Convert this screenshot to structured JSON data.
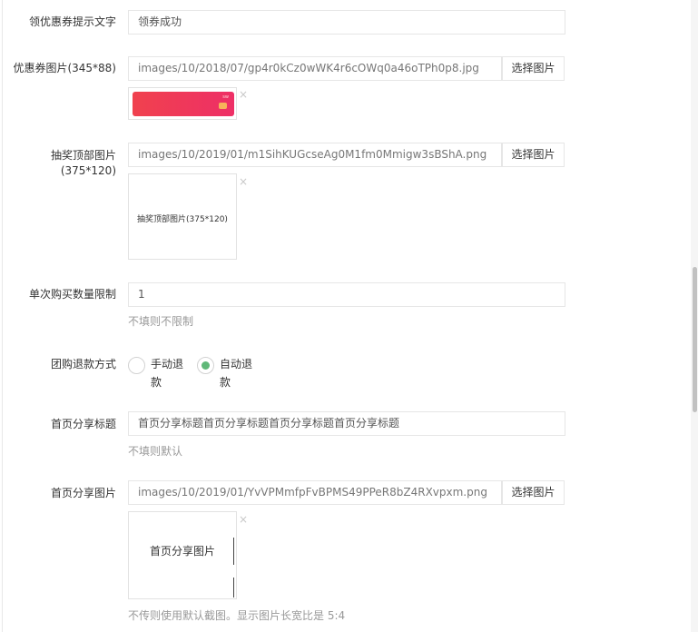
{
  "form": {
    "coupon_tip": {
      "label": "领优惠券提示文字",
      "value": "领券成功"
    },
    "coupon_image": {
      "label": "优惠券图片(345*88)",
      "path": "images/10/2018/07/gp4r0kCz0wWK4r6cOWq0a46oTPh0p8.jpg",
      "button": "选择图片",
      "remove": "×"
    },
    "lottery_top_image": {
      "label_line1": "抽奖顶部图片",
      "label_line2": "(375*120)",
      "path": "images/10/2019/01/m1SihKUGcseAg0M1fm0Mmigw3sBShA.png",
      "button": "选择图片",
      "preview_text": "抽奖顶部图片(375*120)",
      "remove": "×"
    },
    "single_buy_limit": {
      "label": "单次购买数量限制",
      "value": "1",
      "hint": "不填则不限制"
    },
    "refund_method": {
      "label": "团购退款方式",
      "options": [
        {
          "line1": "手动退",
          "line2": "款",
          "selected": false
        },
        {
          "line1": "自动退",
          "line2": "款",
          "selected": true
        }
      ]
    },
    "share_title": {
      "label": "首页分享标题",
      "value": "首页分享标题首页分享标题首页分享标题首页分享标题",
      "hint": "不填则默认"
    },
    "share_image": {
      "label": "首页分享图片",
      "path": "images/10/2019/01/YvVPMmfpFvBPMS49PPeR8bZ4RXvpxm.png",
      "button": "选择图片",
      "preview_text": "首页分享图片",
      "remove": "×",
      "hint": "不传则使用默认截图。显示图片长宽比是 5:4"
    }
  },
  "colors": {
    "accent_green": "#5fb878",
    "coupon_red": "#f0414e",
    "border": "#e6e6e6"
  }
}
